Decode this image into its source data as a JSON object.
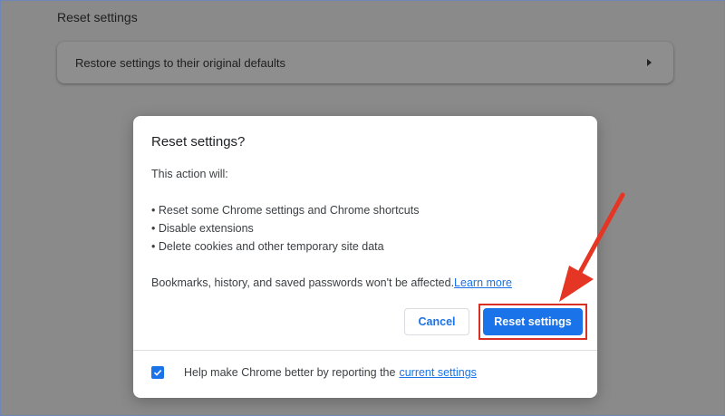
{
  "page": {
    "section_title": "Reset settings",
    "restore_label": "Restore settings to their original defaults"
  },
  "dialog": {
    "title": "Reset settings?",
    "intro": "This action will:",
    "bullets": [
      "• Reset some Chrome settings and Chrome shortcuts",
      "• Disable extensions",
      "• Delete cookies and other temporary site data"
    ],
    "note": "Bookmarks, history, and saved passwords won't be affected.",
    "learn_more": "Learn more",
    "cancel_label": "Cancel",
    "reset_label": "Reset settings",
    "footer_text": "Help make Chrome better by reporting the ",
    "footer_link": "current settings",
    "checkbox_checked": true
  },
  "colors": {
    "accent": "#1a73e8",
    "annotation": "#e53524"
  },
  "icons": {
    "restore_chevron": "arrow-right-icon",
    "checkbox": "check-icon",
    "annotation": "red-arrow-icon"
  }
}
